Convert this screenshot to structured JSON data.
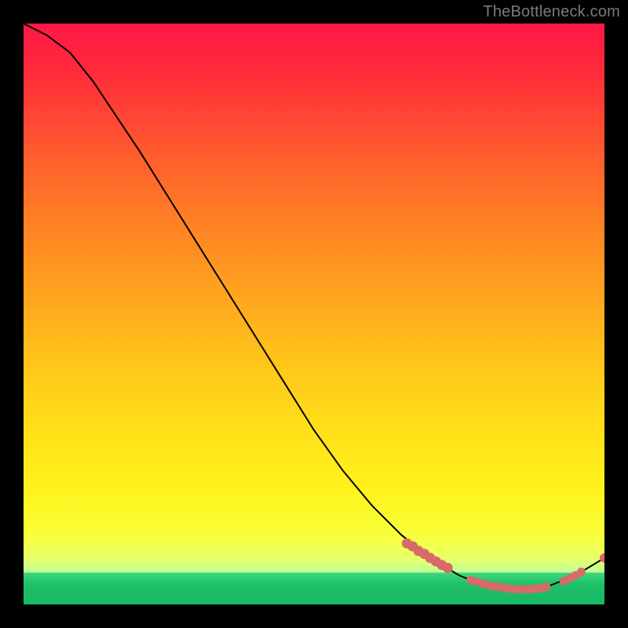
{
  "attribution": "TheBottleneck.com",
  "chart_data": {
    "type": "line",
    "title": "",
    "xlabel": "",
    "ylabel": "",
    "xlim": [
      0,
      100
    ],
    "ylim": [
      0,
      100
    ],
    "curve": [
      {
        "x": 0,
        "y": 100
      },
      {
        "x": 4,
        "y": 98
      },
      {
        "x": 8,
        "y": 95
      },
      {
        "x": 12,
        "y": 90
      },
      {
        "x": 16,
        "y": 84
      },
      {
        "x": 20,
        "y": 78
      },
      {
        "x": 25,
        "y": 70
      },
      {
        "x": 30,
        "y": 62
      },
      {
        "x": 35,
        "y": 54
      },
      {
        "x": 40,
        "y": 46
      },
      {
        "x": 45,
        "y": 38
      },
      {
        "x": 50,
        "y": 30
      },
      {
        "x": 55,
        "y": 23
      },
      {
        "x": 60,
        "y": 17
      },
      {
        "x": 65,
        "y": 12
      },
      {
        "x": 70,
        "y": 8
      },
      {
        "x": 75,
        "y": 5
      },
      {
        "x": 80,
        "y": 3
      },
      {
        "x": 85,
        "y": 2.5
      },
      {
        "x": 90,
        "y": 3
      },
      {
        "x": 95,
        "y": 5
      },
      {
        "x": 100,
        "y": 8
      }
    ],
    "markers_segment": [
      {
        "x": 66,
        "y": 10.5
      },
      {
        "x": 67,
        "y": 10
      },
      {
        "x": 68,
        "y": 9.2
      },
      {
        "x": 69,
        "y": 8.7
      },
      {
        "x": 70,
        "y": 8
      },
      {
        "x": 71,
        "y": 7.4
      },
      {
        "x": 72,
        "y": 6.8
      },
      {
        "x": 73,
        "y": 6.3
      }
    ],
    "markers_bottom": [
      {
        "x": 77,
        "y": 4.2
      },
      {
        "x": 78,
        "y": 3.9
      },
      {
        "x": 79,
        "y": 3.6
      },
      {
        "x": 80,
        "y": 3.3
      },
      {
        "x": 81,
        "y": 3.1
      },
      {
        "x": 82,
        "y": 3.0
      },
      {
        "x": 83,
        "y": 2.8
      },
      {
        "x": 84,
        "y": 2.7
      },
      {
        "x": 85,
        "y": 2.6
      },
      {
        "x": 86,
        "y": 2.6
      },
      {
        "x": 87,
        "y": 2.6
      },
      {
        "x": 88,
        "y": 2.7
      },
      {
        "x": 89,
        "y": 2.8
      },
      {
        "x": 90,
        "y": 3.0
      }
    ],
    "markers_rise": [
      {
        "x": 93,
        "y": 4.0
      },
      {
        "x": 94,
        "y": 4.5
      },
      {
        "x": 95,
        "y": 5.0
      },
      {
        "x": 96,
        "y": 5.6
      }
    ],
    "marker_end": {
      "x": 100,
      "y": 8
    }
  }
}
